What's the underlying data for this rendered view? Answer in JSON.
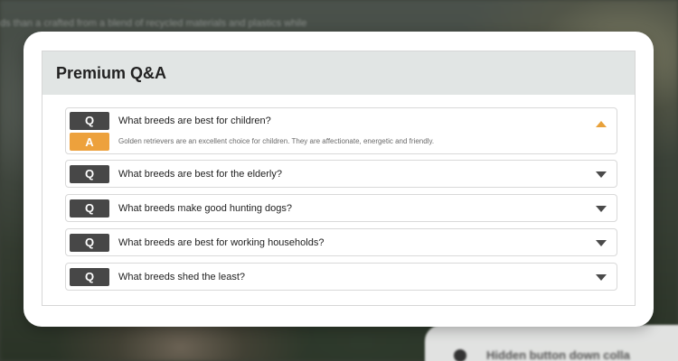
{
  "background": {
    "blurred_text": "ds than a crafted from a blend of recycled materials and plastics while",
    "hint_text": "Hidden button down colla"
  },
  "panel": {
    "title": "Premium Q&A"
  },
  "qa": {
    "q_badge": "Q",
    "a_badge": "A",
    "items": [
      {
        "question": "What breeds are best for children?",
        "answer": "Golden retrievers are an excellent choice for children. They are affectionate, energetic and friendly.",
        "expanded": true
      },
      {
        "question": "What breeds are best for the elderly?",
        "expanded": false
      },
      {
        "question": "What breeds make good hunting dogs?",
        "expanded": false
      },
      {
        "question": "What breeds are best for working households?",
        "expanded": false
      },
      {
        "question": "What breeds shed the least?",
        "expanded": false
      }
    ]
  },
  "colors": {
    "q_badge": "#474747",
    "a_badge": "#eda13c",
    "header_bg": "#e1e5e4",
    "chevron_open": "#e8a13a",
    "chevron_closed": "#4a4a4a"
  },
  "icons": {
    "open_item": "chevron-up-icon",
    "closed_item": "chevron-down-icon"
  }
}
